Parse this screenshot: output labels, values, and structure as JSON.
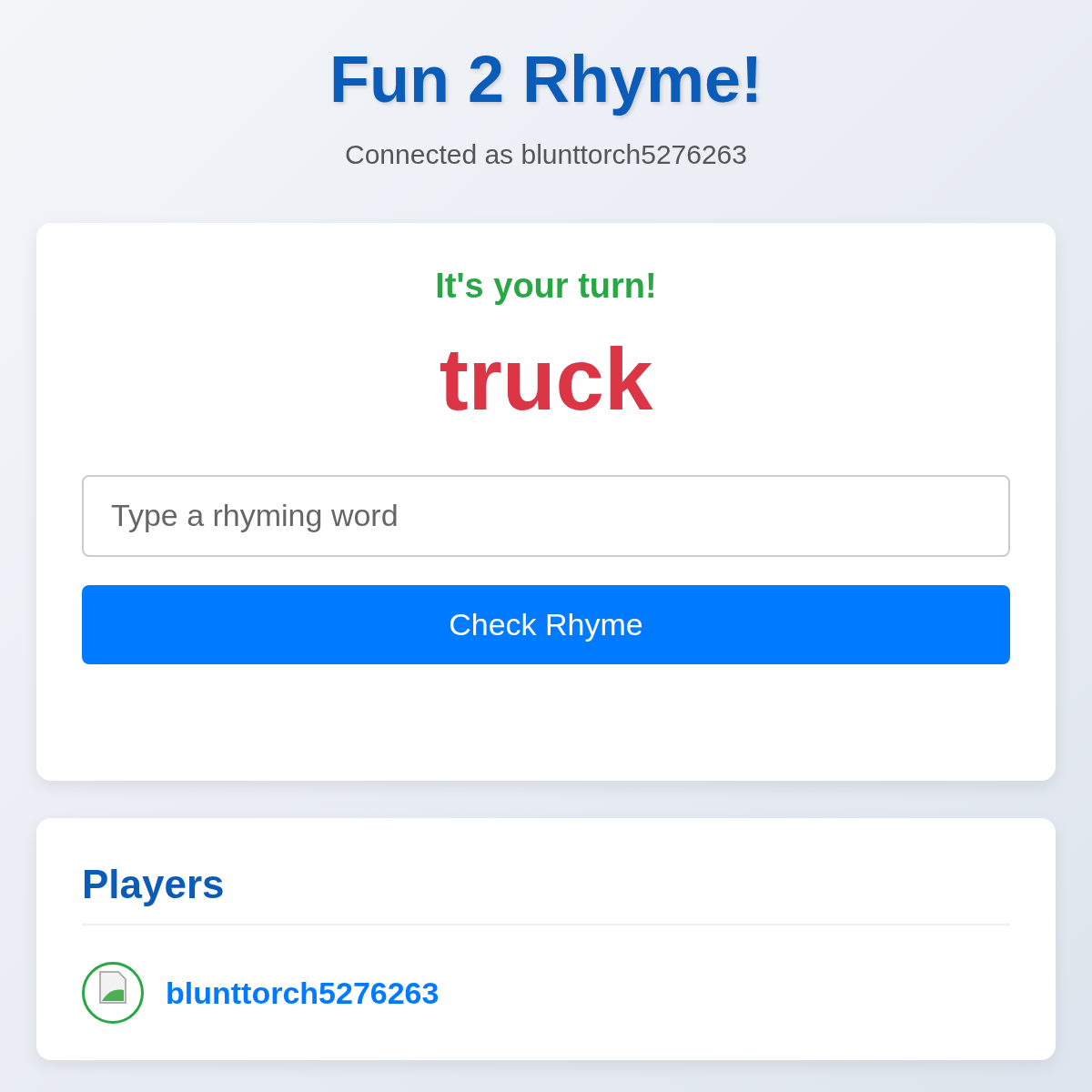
{
  "header": {
    "title": "Fun 2 Rhyme!",
    "subtitle": "Connected as blunttorch5276263"
  },
  "game": {
    "turn_message": "It's your turn!",
    "word": "truck",
    "input": {
      "placeholder": "Type a rhyming word"
    },
    "button": "Check Rhyme"
  },
  "players": {
    "heading": "Players",
    "items": [
      {
        "name": "blunttorch5276263",
        "active": true
      }
    ]
  }
}
